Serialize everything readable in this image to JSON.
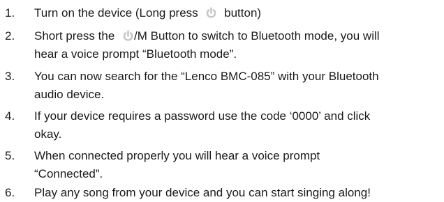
{
  "steps": [
    {
      "number": "1.",
      "lines": [
        {
          "before": "Turn on the device (Long press",
          "after": "button)"
        }
      ]
    },
    {
      "number": "2.",
      "lines": [
        {
          "before": "Short press the",
          "after": "/M Button to switch to Bluetooth mode, you will"
        },
        {
          "text": "hear a voice prompt “Bluetooth mode”."
        }
      ]
    },
    {
      "number": "3.",
      "lines": [
        {
          "text": "You can now search for the “Lenco BMC-085” with your Bluetooth"
        },
        {
          "text": "audio device."
        }
      ]
    },
    {
      "number": "4.",
      "lines": [
        {
          "text": "If your device requires a password use the code ‘0000’ and click"
        },
        {
          "text": "okay."
        }
      ]
    },
    {
      "number": "5.",
      "lines": [
        {
          "text": "When connected properly you will hear a voice prompt"
        },
        {
          "text": "“Connected”."
        }
      ]
    },
    {
      "number": "6.",
      "lines": [
        {
          "text": "Play any song from your device and you can start singing along!"
        }
      ]
    }
  ],
  "icons": {
    "power": "power-icon",
    "color": "#c7c7c7"
  }
}
